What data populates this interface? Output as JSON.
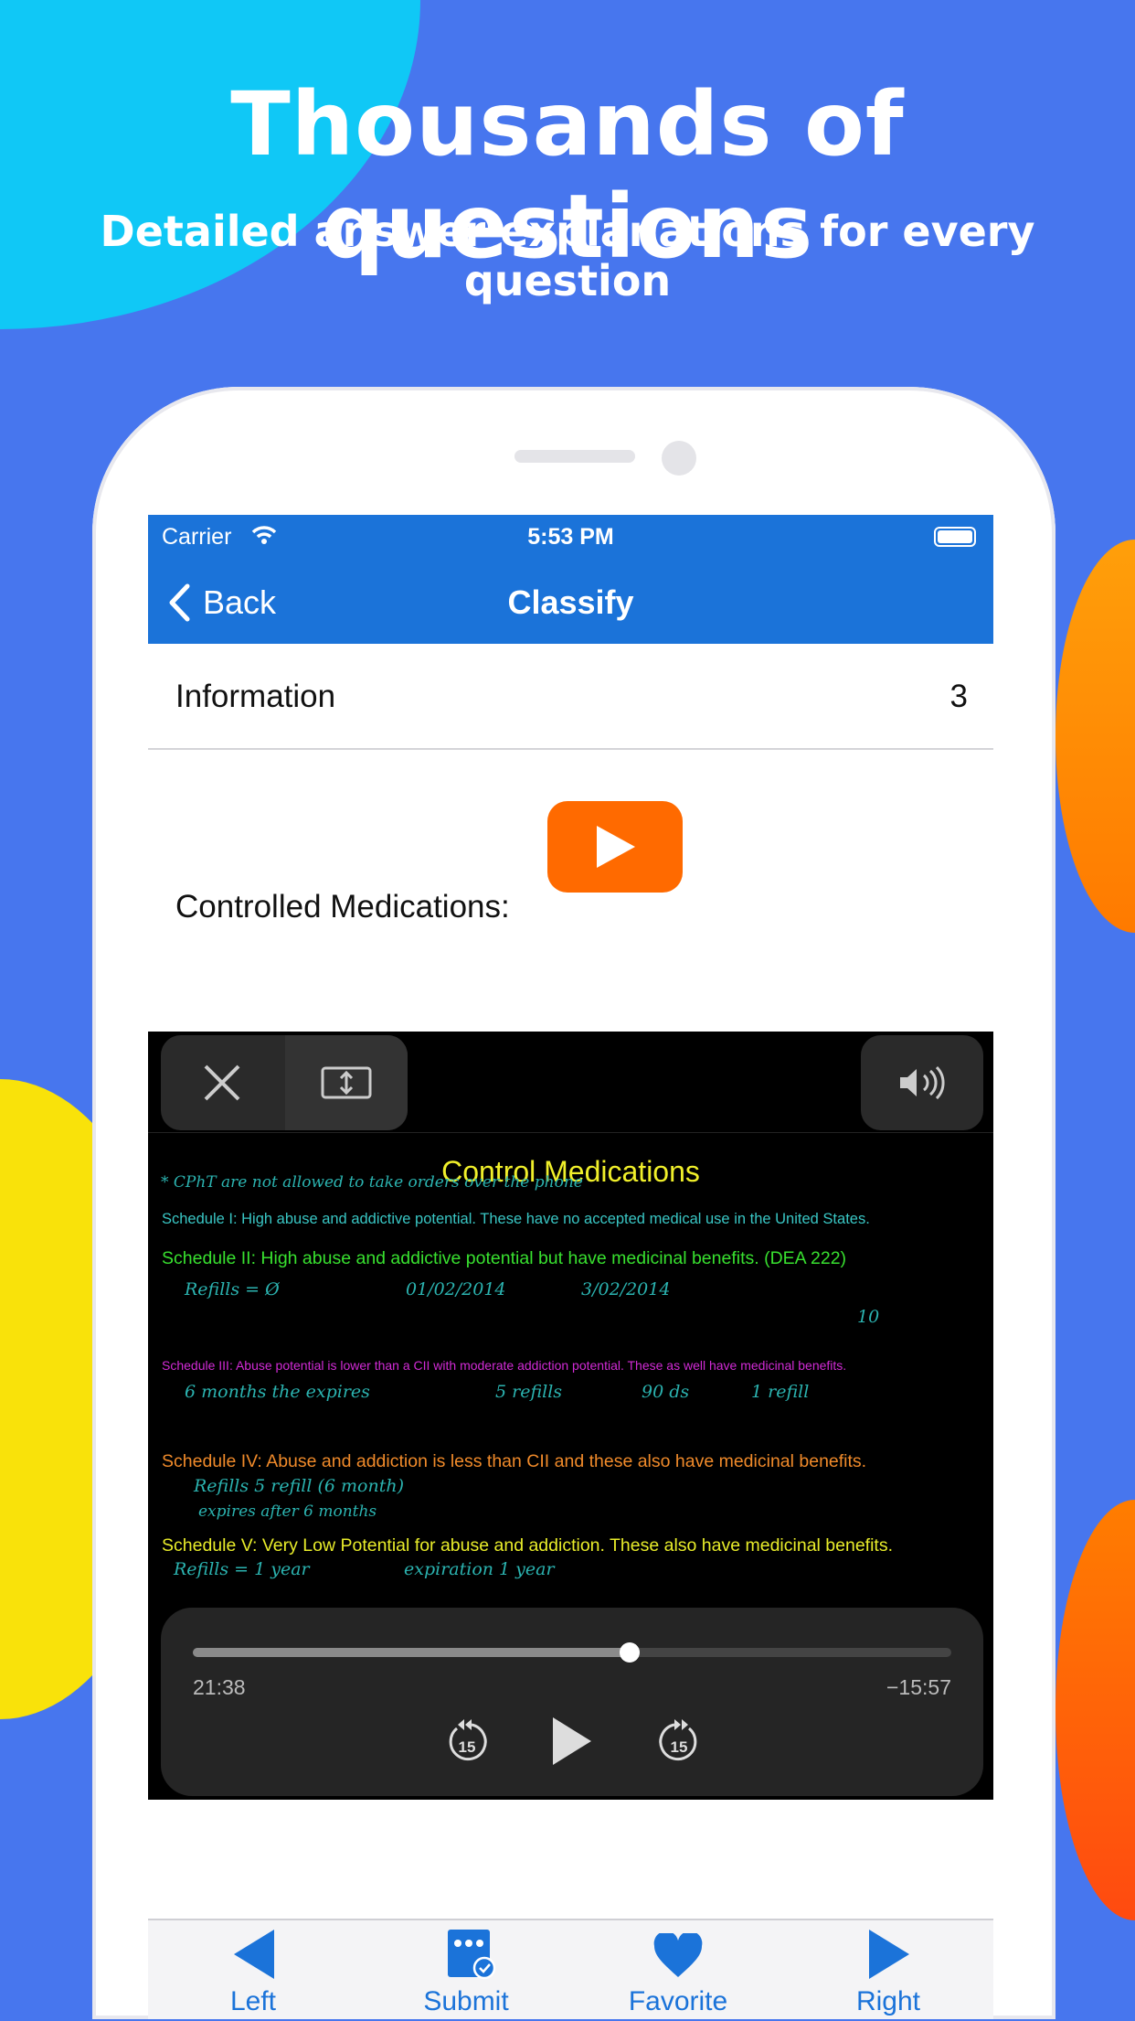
{
  "promo": {
    "headline": "Thousands of questions",
    "subheadline": "Detailed answer explanations for every question"
  },
  "status_bar": {
    "carrier": "Carrier",
    "time": "5:53 PM"
  },
  "nav": {
    "back_label": "Back",
    "title": "Classify"
  },
  "info_row": {
    "label": "Information",
    "count": "3"
  },
  "content": {
    "text": "Controlled Medications:",
    "play_button_color": "#ff6a00"
  },
  "video": {
    "slide_title": "Control Medications",
    "note_top": "* CPhT are not allowed to take orders over the phone",
    "schedules": [
      {
        "text": "Schedule I: High abuse and addictive potential. These have no accepted medical use in the United States.",
        "color": "#39c6c4"
      },
      {
        "text": "Schedule II: High abuse and addictive potential but have medicinal benefits. (DEA 222)",
        "color": "#38e02f"
      },
      {
        "text": "Schedule III: Abuse potential is lower than a CII with moderate addiction potential. These as well have medicinal benefits.",
        "color": "#d22bd6"
      },
      {
        "text": "Schedule IV: Abuse and addiction is less than CII and these also have medicinal benefits.",
        "color": "#f08a2a"
      },
      {
        "text": "Schedule V: Very Low Potential for abuse and addiction. These also have medicinal benefits.",
        "color": "#e8ec2a"
      }
    ],
    "notes": {
      "s2_refills": "Refills = Ø",
      "s2_date1": "01/02/2014",
      "s2_date2": "3/02/2014",
      "s2_ten": "10",
      "s3": [
        "6 months the expires",
        "5 refills",
        "90 ds",
        "1 refill"
      ],
      "s4_a": "Refills 5 refill (6 month)",
      "s4_b": "expires after 6 months",
      "s5": [
        "Refills = 1 year",
        "expiration 1 year"
      ]
    },
    "elapsed": "21:38",
    "remaining": "−15:57",
    "progress": 0.576,
    "skip_seconds": "15"
  },
  "toolbar": {
    "left": "Left",
    "submit": "Submit",
    "favorite": "Favorite",
    "right": "Right",
    "accent": "#1b73d9"
  }
}
